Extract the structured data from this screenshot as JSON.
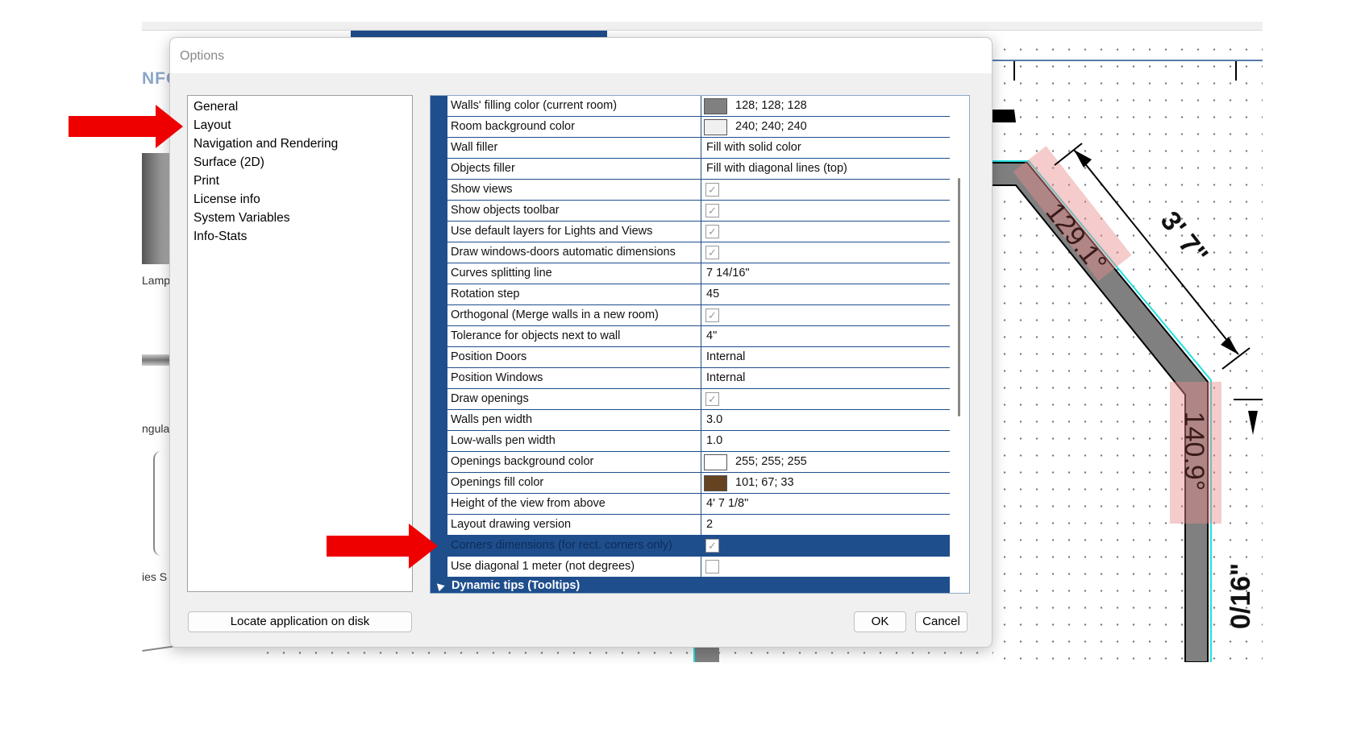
{
  "background": {
    "logo_text": "NFO",
    "side_labels": [
      "Lamp",
      "ngula",
      "ies S"
    ]
  },
  "drawing": {
    "dimension_label": "3' 7\"",
    "angle_label_1": "129.1°",
    "angle_label_2": "140.9°",
    "side_dimension_label": "0/16\""
  },
  "dialog": {
    "title": "Options",
    "categories": [
      "General",
      "Layout",
      "Navigation and Rendering",
      "Surface (2D)",
      "Print",
      "License info",
      "System Variables",
      "Info-Stats"
    ],
    "properties": [
      {
        "name": "Walls' filling color (current room)",
        "type": "color",
        "color": "#808080",
        "value": "128; 128; 128"
      },
      {
        "name": "Room background color",
        "type": "color",
        "color": "#f0f0f0",
        "value": "240; 240; 240"
      },
      {
        "name": "Wall filler",
        "type": "text",
        "value": "Fill with solid color"
      },
      {
        "name": "Objects filler",
        "type": "text",
        "value": "Fill with diagonal lines (top)"
      },
      {
        "name": "Show views",
        "type": "check",
        "checked": true
      },
      {
        "name": "Show objects toolbar",
        "type": "check",
        "checked": true
      },
      {
        "name": "Use default layers for Lights and Views",
        "type": "check",
        "checked": true
      },
      {
        "name": "Draw windows-doors automatic dimensions",
        "type": "check",
        "checked": true
      },
      {
        "name": "Curves splitting line",
        "type": "text",
        "value": "7 14/16\""
      },
      {
        "name": "Rotation step",
        "type": "text",
        "value": "45"
      },
      {
        "name": "Orthogonal (Merge walls in a new room)",
        "type": "check",
        "checked": true
      },
      {
        "name": "Tolerance for objects next to wall",
        "type": "text",
        "value": "4\""
      },
      {
        "name": "Position Doors",
        "type": "text",
        "value": "Internal"
      },
      {
        "name": "Position Windows",
        "type": "text",
        "value": "Internal"
      },
      {
        "name": "Draw openings",
        "type": "check",
        "checked": true
      },
      {
        "name": "Walls pen width",
        "type": "text",
        "value": "3.0"
      },
      {
        "name": "Low-walls pen width",
        "type": "text",
        "value": "1.0"
      },
      {
        "name": "Openings background color",
        "type": "color",
        "color": "#ffffff",
        "value": "255; 255; 255"
      },
      {
        "name": "Openings fill color",
        "type": "color",
        "color": "#654321",
        "value": "101; 67; 33"
      },
      {
        "name": "Height of the view from above",
        "type": "text",
        "value": "4' 7 1/8\""
      },
      {
        "name": "Layout drawing version",
        "type": "text",
        "value": "2"
      },
      {
        "name": "Corners dimensions (for rect. corners only)",
        "type": "check",
        "checked": true,
        "selected": true
      },
      {
        "name": "Use diagonal 1 meter (not degrees)",
        "type": "check",
        "checked": false
      }
    ],
    "section_header": "Dynamic tips (Tooltips)",
    "buttons": {
      "locate": "Locate application on disk",
      "ok": "OK",
      "cancel": "Cancel"
    }
  },
  "colors": {
    "accent_blue": "#1f4e8c",
    "annotation_red": "#ee0000"
  }
}
